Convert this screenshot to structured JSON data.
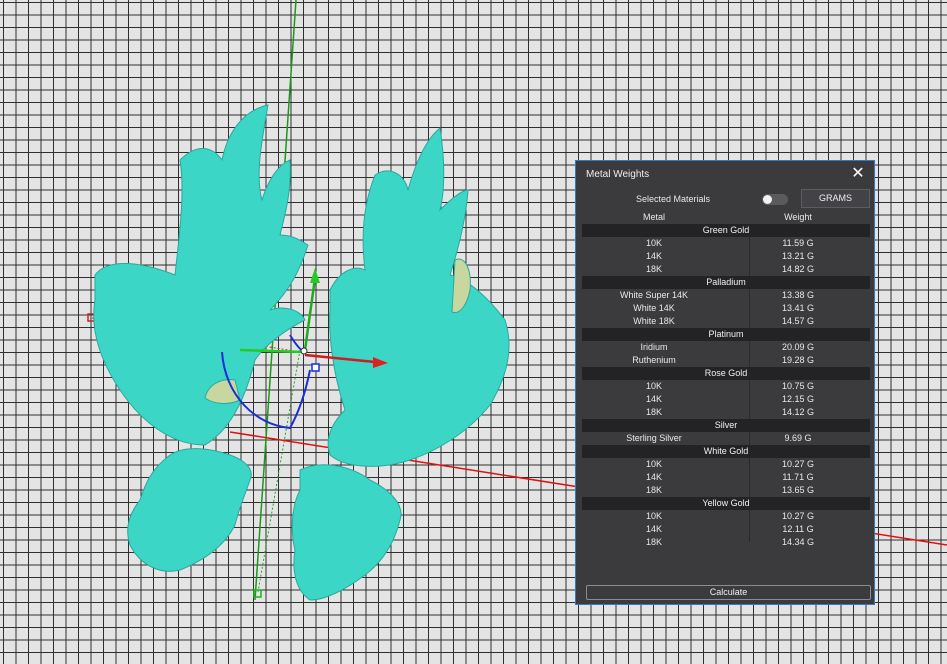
{
  "panel": {
    "title": "Metal Weights",
    "close_icon": "close-icon",
    "selected_materials_label": "Selected Materials",
    "selected_materials_on": false,
    "unit_button": "GRAMS",
    "columns": [
      "Metal",
      "Weight"
    ],
    "groups": [
      {
        "name": "Green Gold",
        "rows": [
          [
            "10K",
            "11.59 G"
          ],
          [
            "14K",
            "13.21 G"
          ],
          [
            "18K",
            "14.82 G"
          ]
        ]
      },
      {
        "name": "Palladium",
        "rows": [
          [
            "White Super 14K",
            "13.38 G"
          ],
          [
            "White 14K",
            "13.41 G"
          ],
          [
            "White 18K",
            "14.57 G"
          ]
        ]
      },
      {
        "name": "Platinum",
        "rows": [
          [
            "Iridium",
            "20.09 G"
          ],
          [
            "Ruthenium",
            "19.28 G"
          ]
        ]
      },
      {
        "name": "Rose Gold",
        "rows": [
          [
            "10K",
            "10.75 G"
          ],
          [
            "14K",
            "12.15 G"
          ],
          [
            "18K",
            "14.12 G"
          ]
        ]
      },
      {
        "name": "Silver",
        "rows": [
          [
            "Sterling Silver",
            "9.69 G"
          ]
        ]
      },
      {
        "name": "White Gold",
        "rows": [
          [
            "10K",
            "10.27 G"
          ],
          [
            "14K",
            "11.71 G"
          ],
          [
            "18K",
            "13.65 G"
          ]
        ]
      },
      {
        "name": "Yellow Gold",
        "rows": [
          [
            "10K",
            "10.27 G"
          ],
          [
            "14K",
            "12.11 G"
          ],
          [
            "18K",
            "14.34 G"
          ]
        ]
      }
    ],
    "calculate_button": "Calculate"
  },
  "viewport": {
    "model_color": "#3cd6c6",
    "axis_x_color": "#e01010",
    "axis_y_color": "#1a9a1a",
    "gizmo_rotate_color": "#1b2fd6"
  }
}
